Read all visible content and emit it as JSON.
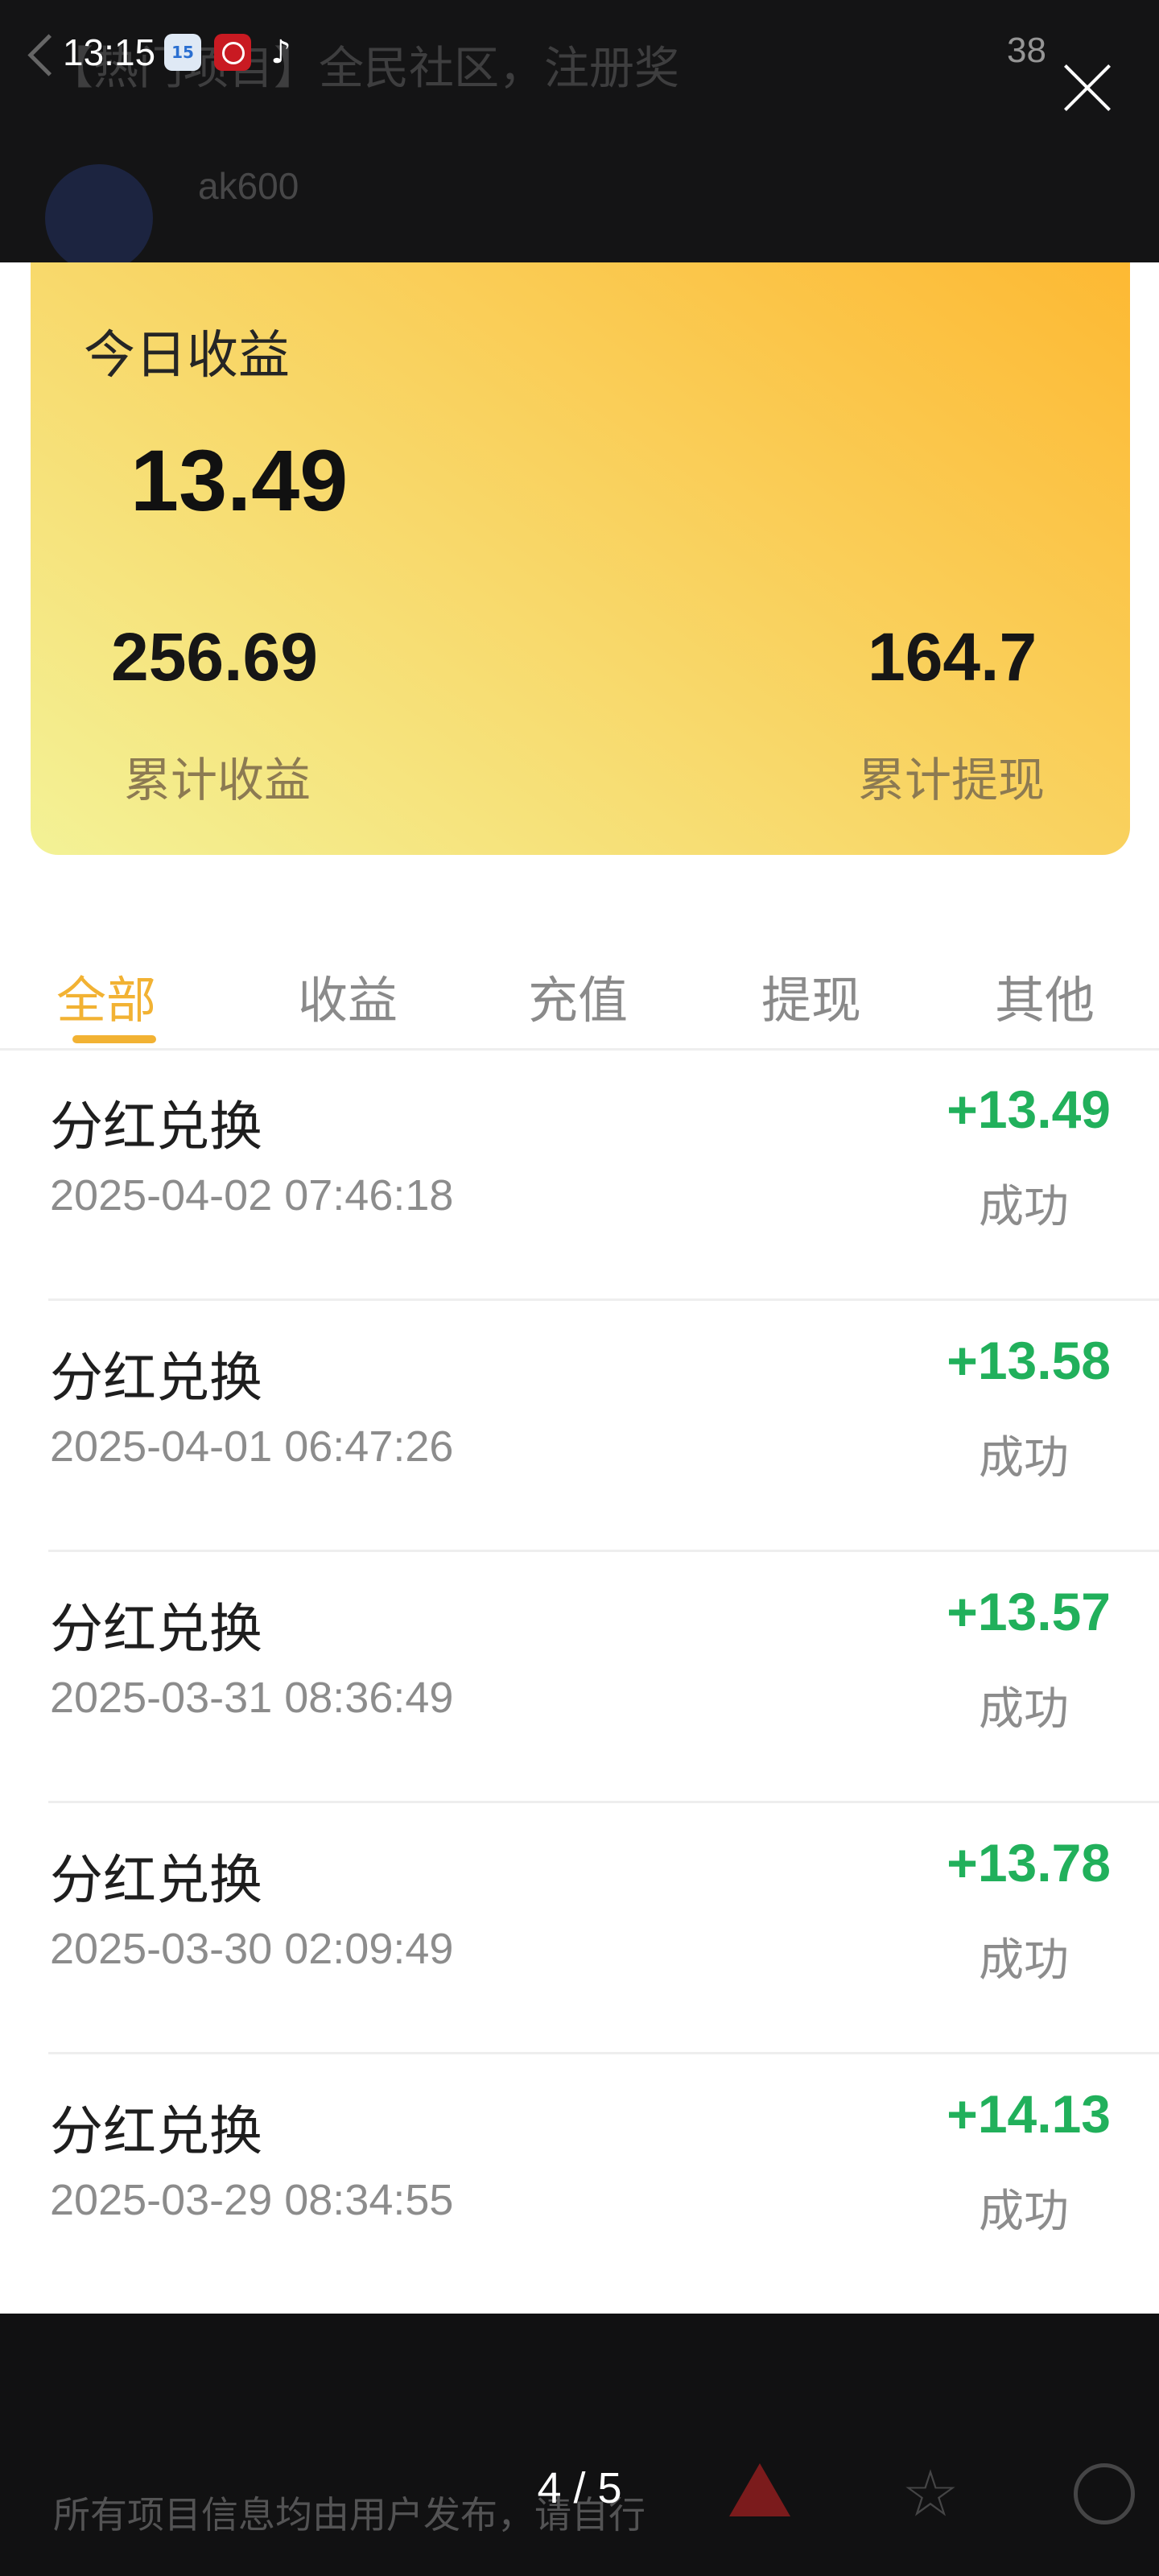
{
  "viewer": {
    "status_time": "13:15",
    "status_icons": {
      "calendar_day": "15"
    },
    "behind_title": "【热门项目】全民社区，注册奖",
    "behind_status_right": "38",
    "behind_username": "ak600",
    "close_icon": "close-x-icon",
    "page_indicator": "4 / 5",
    "behind_notice": "所有项目信息均由用户发布，请自行"
  },
  "earnings_card": {
    "today_label": "今日收益",
    "today_value": "13.49",
    "total_value": "256.69",
    "total_label": "累计收益",
    "withdraw_value": "164.7",
    "withdraw_label": "累计提现"
  },
  "tabs": [
    {
      "label": "全部",
      "active": true
    },
    {
      "label": "收益",
      "active": false
    },
    {
      "label": "充值",
      "active": false
    },
    {
      "label": "提现",
      "active": false
    },
    {
      "label": "其他",
      "active": false
    }
  ],
  "transactions": [
    {
      "title": "分红兑换",
      "time": "2025-04-02 07:46:18",
      "amount": "+13.49",
      "status": "成功"
    },
    {
      "title": "分红兑换",
      "time": "2025-04-01 06:47:26",
      "amount": "+13.58",
      "status": "成功"
    },
    {
      "title": "分红兑换",
      "time": "2025-03-31 08:36:49",
      "amount": "+13.57",
      "status": "成功"
    },
    {
      "title": "分红兑换",
      "time": "2025-03-30 02:09:49",
      "amount": "+13.78",
      "status": "成功"
    },
    {
      "title": "分红兑换",
      "time": "2025-03-29 08:34:55",
      "amount": "+14.13",
      "status": "成功"
    }
  ],
  "colors": {
    "accent": "#f2b233",
    "positive_amount": "#21b05b",
    "card_gradient_start": "#f3f296",
    "card_gradient_end": "#fdb933"
  }
}
